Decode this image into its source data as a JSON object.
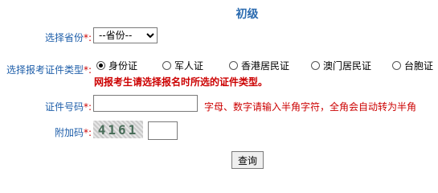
{
  "title": "初级",
  "province": {
    "label": "选择省份",
    "required_mark": "*:",
    "selected": "--省份--"
  },
  "id_type": {
    "label": "选择报考证件类型",
    "required_mark": "*:",
    "options": [
      "身份证",
      "军人证",
      "香港居民证",
      "澳门居民证",
      "台胞证"
    ],
    "selected_index": 0,
    "warning": "网报考生请选择报名时所选的证件类型。"
  },
  "id_number": {
    "label": "证件号码",
    "required_mark": "*:",
    "value": "",
    "hint": "字母、数字请输入半角字符，全角会自动转为半角"
  },
  "captcha": {
    "label": "附加码",
    "required_mark": "*:",
    "image_text": "4161",
    "value": ""
  },
  "query_button": "查询"
}
